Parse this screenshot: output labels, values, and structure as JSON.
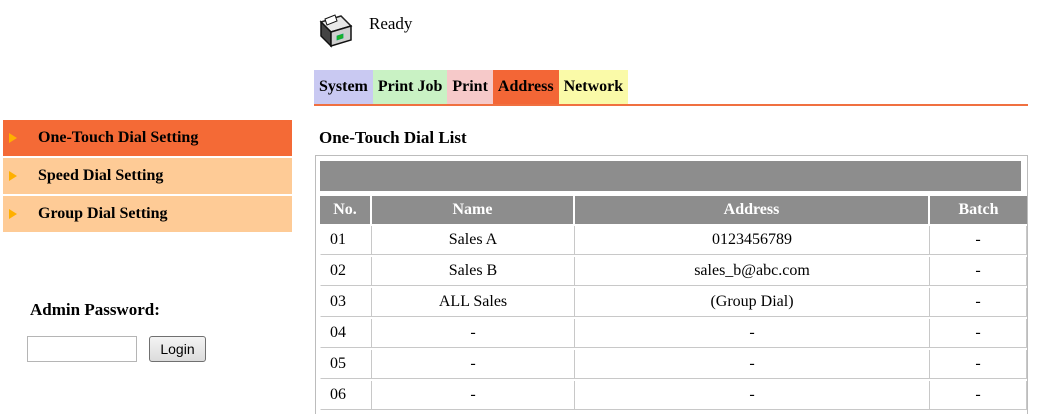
{
  "status": {
    "text": "Ready",
    "icon": "printer-ready-icon"
  },
  "tabs": [
    {
      "label": "System",
      "color": "#c9c9f2"
    },
    {
      "label": "Print Job",
      "color": "#c9f2c4"
    },
    {
      "label": "Print",
      "color": "#f6c9c9"
    },
    {
      "label": "Address",
      "color": "#f36636",
      "active": true
    },
    {
      "label": "Network",
      "color": "#fafaa8"
    }
  ],
  "sidebar": {
    "items": [
      {
        "label": "One-Touch Dial Setting",
        "active": true
      },
      {
        "label": "Speed Dial Setting"
      },
      {
        "label": "Group Dial Setting"
      }
    ],
    "admin_label": "Admin Password:",
    "password_value": "",
    "login_label": "Login"
  },
  "list": {
    "title": "One-Touch Dial List",
    "columns": [
      "No.",
      "Name",
      "Address",
      "Batch"
    ],
    "rows": [
      [
        "01",
        "Sales A",
        "0123456789",
        "-"
      ],
      [
        "02",
        "Sales B",
        "sales_b@abc.com",
        "-"
      ],
      [
        "03",
        "ALL Sales",
        "(Group Dial)",
        "-"
      ],
      [
        "04",
        "-",
        "-",
        "-"
      ],
      [
        "05",
        "-",
        "-",
        "-"
      ],
      [
        "06",
        "-",
        "-",
        "-"
      ]
    ]
  },
  "colors": {
    "accent": "#f36636",
    "sidebar": "#fecb96",
    "header": "#8d8d8d"
  }
}
